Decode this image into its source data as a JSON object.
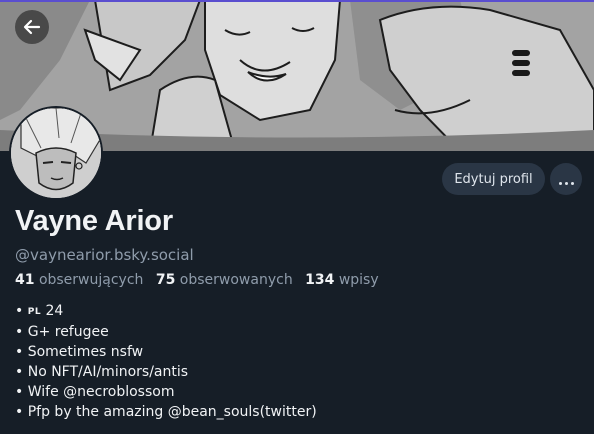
{
  "header": {
    "back_icon": "arrow-left-icon"
  },
  "profile": {
    "display_name": "Vayne Arior",
    "handle": "@vaynearior.bsky.social",
    "edit_label": "Edytuj profil",
    "more_icon": "ellipsis-icon"
  },
  "stats": {
    "followers_count": "41",
    "followers_label": "obserwujących",
    "following_count": "75",
    "following_label": "obserwowanych",
    "posts_count": "134",
    "posts_label": "wpisy"
  },
  "bio": {
    "line1_flag": "PL",
    "line1_text": "24",
    "lines": [
      "G+ refugee",
      "Sometimes nsfw",
      "No NFT/AI/minors/antis",
      "Wife @necroblossom",
      "Pfp by the amazing @bean_souls(twitter)"
    ]
  },
  "colors": {
    "background": "#161e27",
    "button_bg": "#2a3645",
    "muted_text": "#8f9cab",
    "accent_line": "#5a4ecf"
  }
}
